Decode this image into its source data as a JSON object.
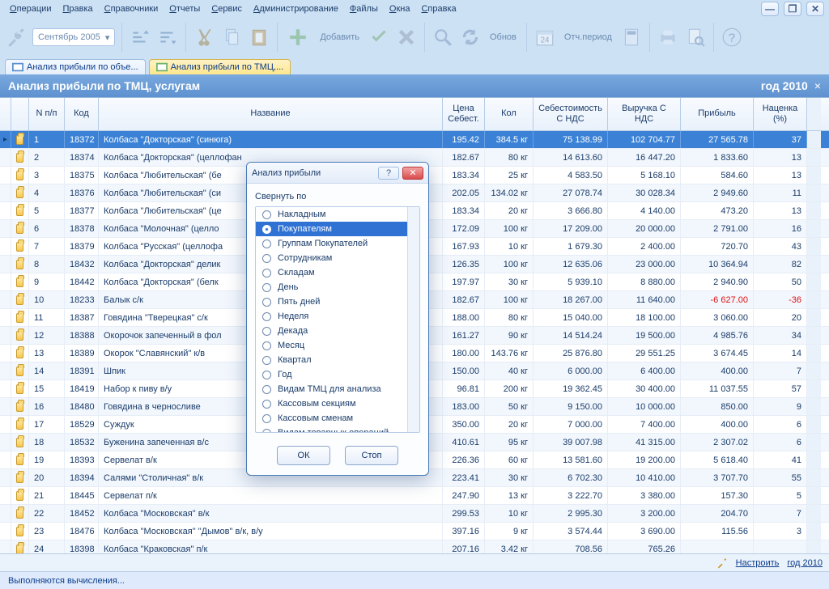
{
  "menu": [
    "Операции",
    "Правка",
    "Справочники",
    "Отчеты",
    "Сервис",
    "Администрирование",
    "Файлы",
    "Окна",
    "Справка"
  ],
  "period": "Сентябрь 2005",
  "toolbar": {
    "add": "Добавить",
    "refresh": "Обнов",
    "period": "Отч.период"
  },
  "tabs": [
    {
      "label": "Анализ прибыли по объе...",
      "active": false
    },
    {
      "label": "Анализ прибыли по ТМЦ,...",
      "active": true
    }
  ],
  "title": {
    "left": "Анализ прибыли по ТМЦ, услугам",
    "right": "год 2010"
  },
  "cols": {
    "n": "N п/п",
    "code": "Код",
    "name": "Название",
    "price": "Цена Себест.",
    "qty": "Кол",
    "cost": "Себестоимость С НДС",
    "rev": "Выручка С НДС",
    "prof": "Прибыль",
    "margin": "Наценка (%)"
  },
  "rows": [
    {
      "n": 1,
      "code": 18372,
      "name": "Колбаса \"Докторская\" (синюга)",
      "price": "195.42",
      "qty": "384.5 кг",
      "cost": "75 138.99",
      "rev": "102 704.77",
      "prof": "27 565.78",
      "margin": "37",
      "sel": true
    },
    {
      "n": 2,
      "code": 18374,
      "name": "Колбаса \"Докторская\" (целлофан",
      "price": "182.67",
      "qty": "80 кг",
      "cost": "14 613.60",
      "rev": "16 447.20",
      "prof": "1 833.60",
      "margin": "13"
    },
    {
      "n": 3,
      "code": 18375,
      "name": "Колбаса \"Любительская\" (бе",
      "price": "183.34",
      "qty": "25 кг",
      "cost": "4 583.50",
      "rev": "5 168.10",
      "prof": "584.60",
      "margin": "13"
    },
    {
      "n": 4,
      "code": 18376,
      "name": "Колбаса \"Любительская\" (си",
      "price": "202.05",
      "qty": "134.02 кг",
      "cost": "27 078.74",
      "rev": "30 028.34",
      "prof": "2 949.60",
      "margin": "11"
    },
    {
      "n": 5,
      "code": 18377,
      "name": "Колбаса \"Любительская\" (це",
      "price": "183.34",
      "qty": "20 кг",
      "cost": "3 666.80",
      "rev": "4 140.00",
      "prof": "473.20",
      "margin": "13"
    },
    {
      "n": 6,
      "code": 18378,
      "name": "Колбаса \"Молочная\" (целло",
      "price": "172.09",
      "qty": "100 кг",
      "cost": "17 209.00",
      "rev": "20 000.00",
      "prof": "2 791.00",
      "margin": "16"
    },
    {
      "n": 7,
      "code": 18379,
      "name": "Колбаса \"Русская\" (целлофа",
      "price": "167.93",
      "qty": "10 кг",
      "cost": "1 679.30",
      "rev": "2 400.00",
      "prof": "720.70",
      "margin": "43"
    },
    {
      "n": 8,
      "code": 18432,
      "name": "Колбаса \"Докторская\" делик",
      "price": "126.35",
      "qty": "100 кг",
      "cost": "12 635.06",
      "rev": "23 000.00",
      "prof": "10 364.94",
      "margin": "82"
    },
    {
      "n": 9,
      "code": 18442,
      "name": "Колбаса \"Докторская\" (белк",
      "price": "197.97",
      "qty": "30 кг",
      "cost": "5 939.10",
      "rev": "8 880.00",
      "prof": "2 940.90",
      "margin": "50"
    },
    {
      "n": 10,
      "code": 18233,
      "name": "Балык с/к",
      "price": "182.67",
      "qty": "100 кг",
      "cost": "18 267.00",
      "rev": "11 640.00",
      "prof": "-6 627.00",
      "margin": "-36",
      "neg": true
    },
    {
      "n": 11,
      "code": 18387,
      "name": "Говядина \"Тверецкая\" с/к",
      "price": "188.00",
      "qty": "80 кг",
      "cost": "15 040.00",
      "rev": "18 100.00",
      "prof": "3 060.00",
      "margin": "20"
    },
    {
      "n": 12,
      "code": 18388,
      "name": "Окорочок запеченный в фол",
      "price": "161.27",
      "qty": "90 кг",
      "cost": "14 514.24",
      "rev": "19 500.00",
      "prof": "4 985.76",
      "margin": "34"
    },
    {
      "n": 13,
      "code": 18389,
      "name": "Окорок \"Славянский\" к/в",
      "price": "180.00",
      "qty": "143.76 кг",
      "cost": "25 876.80",
      "rev": "29 551.25",
      "prof": "3 674.45",
      "margin": "14"
    },
    {
      "n": 14,
      "code": 18391,
      "name": "Шпик",
      "price": "150.00",
      "qty": "40 кг",
      "cost": "6 000.00",
      "rev": "6 400.00",
      "prof": "400.00",
      "margin": "7"
    },
    {
      "n": 15,
      "code": 18419,
      "name": "Набор к пиву в/у",
      "price": "96.81",
      "qty": "200 кг",
      "cost": "19 362.45",
      "rev": "30 400.00",
      "prof": "11 037.55",
      "margin": "57"
    },
    {
      "n": 16,
      "code": 18480,
      "name": "Говядина в черносливе",
      "price": "183.00",
      "qty": "50 кг",
      "cost": "9 150.00",
      "rev": "10 000.00",
      "prof": "850.00",
      "margin": "9"
    },
    {
      "n": 17,
      "code": 18529,
      "name": "Суждук",
      "price": "350.00",
      "qty": "20 кг",
      "cost": "7 000.00",
      "rev": "7 400.00",
      "prof": "400.00",
      "margin": "6"
    },
    {
      "n": 18,
      "code": 18532,
      "name": "Буженина запеченная в/с",
      "price": "410.61",
      "qty": "95 кг",
      "cost": "39 007.98",
      "rev": "41 315.00",
      "prof": "2 307.02",
      "margin": "6"
    },
    {
      "n": 19,
      "code": 18393,
      "name": "Сервелат в/к",
      "price": "226.36",
      "qty": "60 кг",
      "cost": "13 581.60",
      "rev": "19 200.00",
      "prof": "5 618.40",
      "margin": "41"
    },
    {
      "n": 20,
      "code": 18394,
      "name": "Салями \"Столичная\" в/к",
      "price": "223.41",
      "qty": "30 кг",
      "cost": "6 702.30",
      "rev": "10 410.00",
      "prof": "3 707.70",
      "margin": "55"
    },
    {
      "n": 21,
      "code": 18445,
      "name": "Сервелат п/к",
      "price": "247.90",
      "qty": "13 кг",
      "cost": "3 222.70",
      "rev": "3 380.00",
      "prof": "157.30",
      "margin": "5"
    },
    {
      "n": 22,
      "code": 18452,
      "name": "Колбаса \"Московская\" в/к",
      "price": "299.53",
      "qty": "10 кг",
      "cost": "2 995.30",
      "rev": "3 200.00",
      "prof": "204.70",
      "margin": "7"
    },
    {
      "n": 23,
      "code": 18476,
      "name": "Колбаса \"Московская\" \"Дымов\" в/к, в/у",
      "price": "397.16",
      "qty": "9 кг",
      "cost": "3 574.44",
      "rev": "3 690.00",
      "prof": "115.56",
      "margin": "3"
    },
    {
      "n": 24,
      "code": 18398,
      "name": "Колбаса \"Краковская\" п/к",
      "price": "207.16",
      "qty": "3.42 кг",
      "cost": "708.56",
      "rev": "765.26",
      "prof": "",
      "margin": ""
    }
  ],
  "bottom": {
    "configure": "Настроить",
    "period": "год 2010"
  },
  "status": "Выполняются вычисления...",
  "dialog": {
    "title": "Анализ прибыли",
    "group_by": "Свернуть по",
    "options": [
      "Накладным",
      "Покупателям",
      "Группам Покупателей",
      "Сотрудникам",
      "Складам",
      "День",
      "Пять дней",
      "Неделя",
      "Декада",
      "Месяц",
      "Квартал",
      "Год",
      "Видам ТМЦ для анализа",
      "Кассовым секциям",
      "Кассовым сменам",
      "Видам товарных операций"
    ],
    "selected": 1,
    "ok": "ОК",
    "stop": "Стоп"
  }
}
